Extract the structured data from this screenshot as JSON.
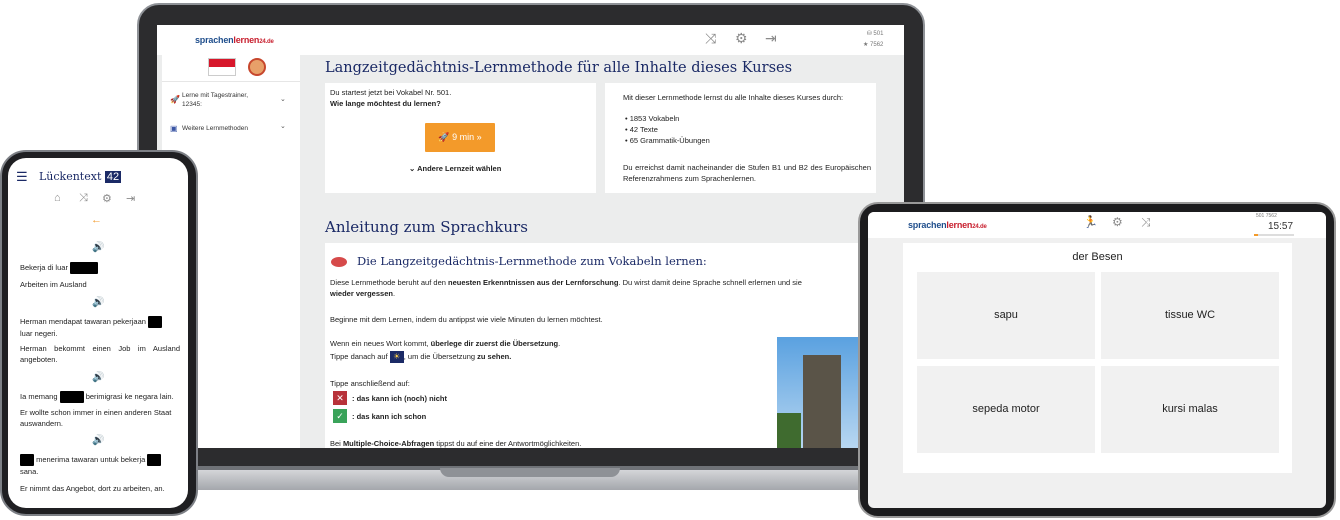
{
  "laptop": {
    "logo": {
      "main": "sprachen",
      "accent": "lernen",
      "suffix": "24.de"
    },
    "stats": {
      "stat1": "501",
      "stat2": "7562"
    },
    "sidebar": {
      "item1_label": "Lerne mit Tagestrainer, 12345:",
      "item2_label": "Weitere Lernmethoden"
    },
    "main": {
      "title": "Langzeitgedächtnis-Lernmethode für alle Inhalte dieses Kurses",
      "start_text": "Du startest jetzt bei Vokabel Nr. 501.",
      "question": "Wie lange möchtest du lernen?",
      "start_button": "9 min",
      "other_time": "Andere Lernzeit wählen",
      "info_intro": "Mit dieser Lernmethode lernst du alle Inhalte dieses Kurses durch:",
      "info_items": [
        "1853 Vokabeln",
        "42 Texte",
        "65 Grammatik-Übungen"
      ],
      "info_levels": "Du erreichst damit nacheinander die Stufen B1 und B2 des Europäischen Referenzrahmens zum Sprachenlernen.",
      "section_title": "Anleitung zum Sprachkurs",
      "subsection_title": "Die Langzeitgedächtnis-Lernmethode zum Vokabeln lernen:",
      "p1_a": "Diese Lernmethode beruht auf den ",
      "p1_b": "neuesten Erkenntnissen aus der Lernforschung",
      "p1_c": ". Du wirst damit deine Sprache schnell erlernen und sie ",
      "p1_d": "wieder vergessen",
      "p1_e": ".",
      "p2": "Beginne mit dem Lernen, indem du antippst wie viele Minuten du lernen möchtest.",
      "p3_a": "Wenn ein neues Wort kommt, ",
      "p3_b": "überlege dir zuerst die Übersetzung",
      "p3_c": ".",
      "p4_a": "Tippe danach auf ",
      "p4_b": ", um die Übersetzung ",
      "p4_c": "zu sehen.",
      "p5": "Tippe anschließend auf:",
      "opt_no": ": das kann ich (noch) nicht",
      "opt_yes": ": das kann ich schon",
      "p6_a": "Bei ",
      "p6_b": "Multiple-Choice-Abfragen",
      "p6_c": " tippst du auf eine der Antwortmöglichkeiten."
    }
  },
  "phone": {
    "title": "Lückentext",
    "badge": "42",
    "lines": [
      {
        "a": "Bekerja di luar",
        "tr": "Arbeiten im Ausland"
      },
      {
        "a": "Herman mendapat tawaran pekerjaan",
        "a2": "luar negeri.",
        "tr": "Herman bekommt einen Job im Ausland angeboten."
      },
      {
        "a": "Ia memang",
        "a2": "berimigrasi ke negara lain.",
        "tr": "Er wollte schon immer in einen anderen Staat auswandern."
      },
      {
        "a": "menerima tawaran untuk bekerja",
        "a2": "sana.",
        "tr": "Er nimmt das Angebot, dort zu arbeiten, an."
      }
    ]
  },
  "tablet": {
    "logo": {
      "main": "sprachen",
      "accent": "lernen",
      "suffix": "24.de"
    },
    "stats": "501  7562",
    "time": "15:57",
    "word": "der Besen",
    "choices": [
      "sapu",
      "tissue WC",
      "sepeda motor",
      "kursi malas"
    ]
  },
  "colors": {
    "accent": "#1b2a66",
    "orange": "#f39a2a",
    "red": "#c8202f",
    "green": "#3aa35a"
  }
}
